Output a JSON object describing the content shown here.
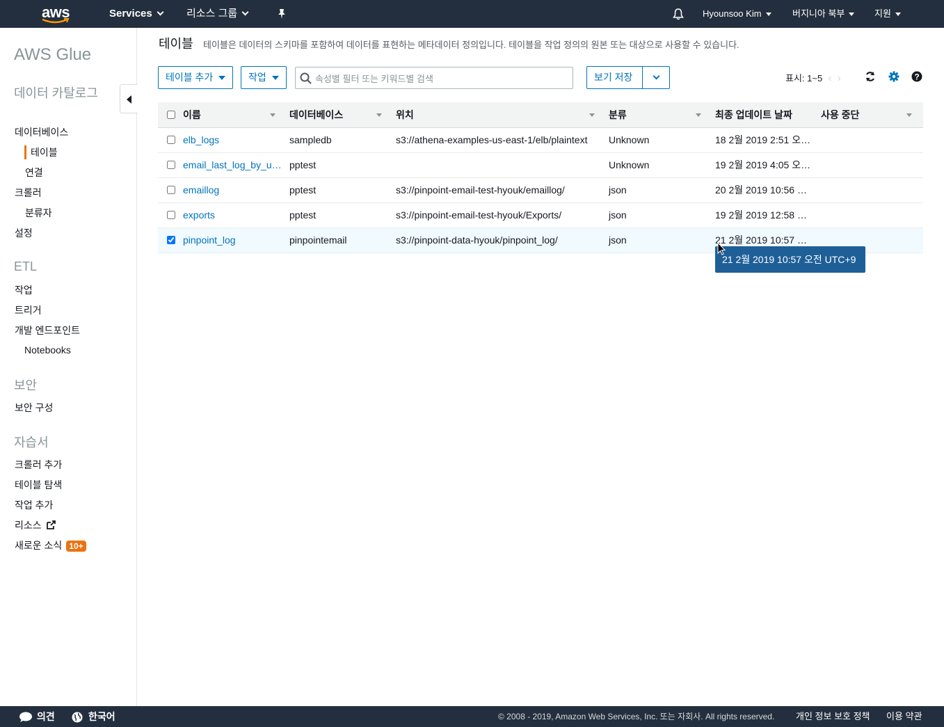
{
  "topnav": {
    "logo_text": "aws",
    "services": "Services",
    "resource_groups": "리소스 그룹",
    "user": "Hyounsoo Kim",
    "region": "버지니아 북부",
    "support": "지원",
    "icons": [
      "bell-icon",
      "pin-icon"
    ]
  },
  "sidebar": {
    "title": "AWS Glue",
    "sections": {
      "catalog": "데이터 카탈로그",
      "etl": "ETL",
      "security": "보안",
      "tutorials": "자습서"
    },
    "items": {
      "databases": "데이터베이스",
      "tables": "테이블",
      "connections": "연결",
      "crawlers": "크롤러",
      "classifiers": "분류자",
      "settings": "설정",
      "jobs": "작업",
      "triggers": "트리거",
      "dev_endpoints": "개발 엔드포인트",
      "notebooks": "Notebooks",
      "security_config": "보안 구성",
      "add_crawler": "크롤러 추가",
      "explore_table": "테이블 탐색",
      "add_job": "작업 추가",
      "resources": "리소스",
      "whats_new": "새로운 소식",
      "whats_new_badge": "10+"
    },
    "active_color": "#ec7211"
  },
  "main": {
    "title": "테이블",
    "description": "테이블은 데이터의 스키마를 포함하여 데이터를 표현하는 메타데이터 정의입니다. 테이블을 작업 정의의 원본 또는 대상으로 사용할 수 있습니다.",
    "toolbar": {
      "add_table": "테이블 추가",
      "action": "작업",
      "search_placeholder": "속성별 필터 또는 키워드별 검색",
      "save_view": "보기 저장",
      "pager": "표시: 1~5"
    },
    "table": {
      "columns": [
        "이름",
        "데이터베이스",
        "위치",
        "분류",
        "최종 업데이트 날짜",
        "사용 중단"
      ],
      "rows": [
        {
          "name": "elb_logs",
          "db": "sampledb",
          "location": "s3://athena-examples-us-east-1/elb/plaintext",
          "classification": "Unknown",
          "updated": "18 2월 2019 2:51 오…",
          "deprecated": "",
          "checked": false
        },
        {
          "name": "email_last_log_by_u…",
          "db": "pptest",
          "location": "",
          "classification": "Unknown",
          "updated": "19 2월 2019 4:05 오…",
          "deprecated": "",
          "checked": false
        },
        {
          "name": "emaillog",
          "db": "pptest",
          "location": "s3://pinpoint-email-test-hyouk/emaillog/",
          "classification": "json",
          "updated": "20 2월 2019 10:56 …",
          "deprecated": "",
          "checked": false
        },
        {
          "name": "exports",
          "db": "pptest",
          "location": "s3://pinpoint-email-test-hyouk/Exports/",
          "classification": "json",
          "updated": "19 2월 2019 12:58 …",
          "deprecated": "",
          "checked": false
        },
        {
          "name": "pinpoint_log",
          "db": "pinpointemail",
          "location": "s3://pinpoint-data-hyouk/pinpoint_log/",
          "classification": "json",
          "updated": "21 2월 2019 10:57 …",
          "deprecated": "",
          "checked": true
        }
      ]
    },
    "tooltip": "21 2월 2019 10:57 오전 UTC+9"
  },
  "footer": {
    "feedback": "의견",
    "language": "한국어",
    "copyright": "© 2008 - 2019, Amazon Web Services, Inc. 또는 자회사. All rights reserved.",
    "privacy": "개인 정보 보호 정책",
    "terms": "이용 약관"
  },
  "colors": {
    "nav_bg": "#232f3e",
    "link": "#0073bb",
    "accent": "#ec7211",
    "selected_row": "#f1faff",
    "tooltip_bg": "#1f5f98"
  }
}
